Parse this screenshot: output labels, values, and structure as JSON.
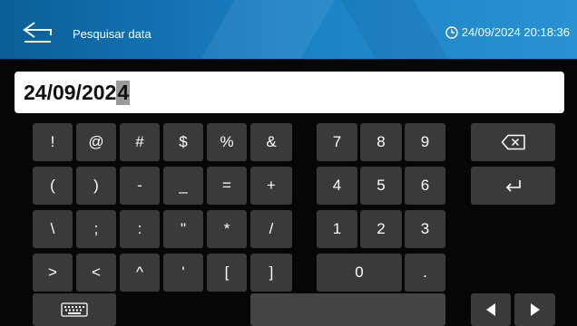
{
  "header": {
    "title": "Pesquisar data",
    "datetime": "24/09/2024 20:18:36",
    "back_icon": "back-arrow-icon",
    "clock_icon": "clock-icon"
  },
  "search": {
    "value_main": "24/09/202",
    "value_caret": "4"
  },
  "keyboard": {
    "symbols": {
      "row1": [
        "!",
        "@",
        "#",
        "$",
        "%",
        "&"
      ],
      "row2": [
        "(",
        ")",
        "-",
        "_",
        "=",
        "+"
      ],
      "row3": [
        "\\",
        ";",
        ":",
        "\"",
        "*",
        "/"
      ],
      "row4": [
        ">",
        "<",
        "^",
        "'",
        "[",
        "]"
      ]
    },
    "numpad": {
      "row1": [
        "7",
        "8",
        "9"
      ],
      "row2": [
        "4",
        "5",
        "6"
      ],
      "row3": [
        "1",
        "2",
        "3"
      ],
      "zero": "0",
      "dot": "."
    },
    "icons": {
      "backspace": "backspace-icon",
      "enter": "enter-icon",
      "keyboard": "keyboard-icon",
      "left": "arrow-left-icon",
      "right": "arrow-right-icon"
    }
  },
  "colors": {
    "header_start": "#0b5f96",
    "header_end": "#2a92d2",
    "key_bg": "#3a3a3a",
    "background": "#060606"
  }
}
